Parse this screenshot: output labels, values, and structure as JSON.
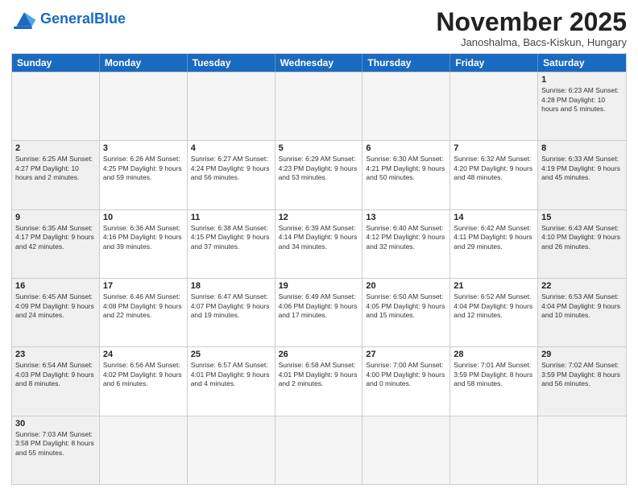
{
  "header": {
    "logo_general": "General",
    "logo_blue": "Blue",
    "month_title": "November 2025",
    "location": "Janoshalma, Bacs-Kiskun, Hungary"
  },
  "weekdays": [
    "Sunday",
    "Monday",
    "Tuesday",
    "Wednesday",
    "Thursday",
    "Friday",
    "Saturday"
  ],
  "rows": [
    [
      {
        "day": "",
        "empty": true
      },
      {
        "day": "",
        "empty": true
      },
      {
        "day": "",
        "empty": true
      },
      {
        "day": "",
        "empty": true
      },
      {
        "day": "",
        "empty": true
      },
      {
        "day": "",
        "empty": true
      },
      {
        "day": "1",
        "info": "Sunrise: 6:23 AM\nSunset: 4:28 PM\nDaylight: 10 hours and 5 minutes.",
        "weekend": true
      }
    ],
    [
      {
        "day": "2",
        "info": "Sunrise: 6:25 AM\nSunset: 4:27 PM\nDaylight: 10 hours and 2 minutes.",
        "weekend": true
      },
      {
        "day": "3",
        "info": "Sunrise: 6:26 AM\nSunset: 4:25 PM\nDaylight: 9 hours and 59 minutes."
      },
      {
        "day": "4",
        "info": "Sunrise: 6:27 AM\nSunset: 4:24 PM\nDaylight: 9 hours and 56 minutes."
      },
      {
        "day": "5",
        "info": "Sunrise: 6:29 AM\nSunset: 4:23 PM\nDaylight: 9 hours and 53 minutes."
      },
      {
        "day": "6",
        "info": "Sunrise: 6:30 AM\nSunset: 4:21 PM\nDaylight: 9 hours and 50 minutes."
      },
      {
        "day": "7",
        "info": "Sunrise: 6:32 AM\nSunset: 4:20 PM\nDaylight: 9 hours and 48 minutes."
      },
      {
        "day": "8",
        "info": "Sunrise: 6:33 AM\nSunset: 4:19 PM\nDaylight: 9 hours and 45 minutes.",
        "weekend": true
      }
    ],
    [
      {
        "day": "9",
        "info": "Sunrise: 6:35 AM\nSunset: 4:17 PM\nDaylight: 9 hours and 42 minutes.",
        "weekend": true
      },
      {
        "day": "10",
        "info": "Sunrise: 6:36 AM\nSunset: 4:16 PM\nDaylight: 9 hours and 39 minutes."
      },
      {
        "day": "11",
        "info": "Sunrise: 6:38 AM\nSunset: 4:15 PM\nDaylight: 9 hours and 37 minutes."
      },
      {
        "day": "12",
        "info": "Sunrise: 6:39 AM\nSunset: 4:14 PM\nDaylight: 9 hours and 34 minutes."
      },
      {
        "day": "13",
        "info": "Sunrise: 6:40 AM\nSunset: 4:12 PM\nDaylight: 9 hours and 32 minutes."
      },
      {
        "day": "14",
        "info": "Sunrise: 6:42 AM\nSunset: 4:11 PM\nDaylight: 9 hours and 29 minutes."
      },
      {
        "day": "15",
        "info": "Sunrise: 6:43 AM\nSunset: 4:10 PM\nDaylight: 9 hours and 26 minutes.",
        "weekend": true
      }
    ],
    [
      {
        "day": "16",
        "info": "Sunrise: 6:45 AM\nSunset: 4:09 PM\nDaylight: 9 hours and 24 minutes.",
        "weekend": true
      },
      {
        "day": "17",
        "info": "Sunrise: 6:46 AM\nSunset: 4:08 PM\nDaylight: 9 hours and 22 minutes."
      },
      {
        "day": "18",
        "info": "Sunrise: 6:47 AM\nSunset: 4:07 PM\nDaylight: 9 hours and 19 minutes."
      },
      {
        "day": "19",
        "info": "Sunrise: 6:49 AM\nSunset: 4:06 PM\nDaylight: 9 hours and 17 minutes."
      },
      {
        "day": "20",
        "info": "Sunrise: 6:50 AM\nSunset: 4:05 PM\nDaylight: 9 hours and 15 minutes."
      },
      {
        "day": "21",
        "info": "Sunrise: 6:52 AM\nSunset: 4:04 PM\nDaylight: 9 hours and 12 minutes."
      },
      {
        "day": "22",
        "info": "Sunrise: 6:53 AM\nSunset: 4:04 PM\nDaylight: 9 hours and 10 minutes.",
        "weekend": true
      }
    ],
    [
      {
        "day": "23",
        "info": "Sunrise: 6:54 AM\nSunset: 4:03 PM\nDaylight: 9 hours and 8 minutes.",
        "weekend": true
      },
      {
        "day": "24",
        "info": "Sunrise: 6:56 AM\nSunset: 4:02 PM\nDaylight: 9 hours and 6 minutes."
      },
      {
        "day": "25",
        "info": "Sunrise: 6:57 AM\nSunset: 4:01 PM\nDaylight: 9 hours and 4 minutes."
      },
      {
        "day": "26",
        "info": "Sunrise: 6:58 AM\nSunset: 4:01 PM\nDaylight: 9 hours and 2 minutes."
      },
      {
        "day": "27",
        "info": "Sunrise: 7:00 AM\nSunset: 4:00 PM\nDaylight: 9 hours and 0 minutes."
      },
      {
        "day": "28",
        "info": "Sunrise: 7:01 AM\nSunset: 3:59 PM\nDaylight: 8 hours and 58 minutes."
      },
      {
        "day": "29",
        "info": "Sunrise: 7:02 AM\nSunset: 3:59 PM\nDaylight: 8 hours and 56 minutes.",
        "weekend": true
      }
    ],
    [
      {
        "day": "30",
        "info": "Sunrise: 7:03 AM\nSunset: 3:58 PM\nDaylight: 8 hours and 55 minutes.",
        "weekend": true
      },
      {
        "day": "",
        "empty": true
      },
      {
        "day": "",
        "empty": true
      },
      {
        "day": "",
        "empty": true
      },
      {
        "day": "",
        "empty": true
      },
      {
        "day": "",
        "empty": true
      },
      {
        "day": "",
        "empty": true
      }
    ]
  ]
}
